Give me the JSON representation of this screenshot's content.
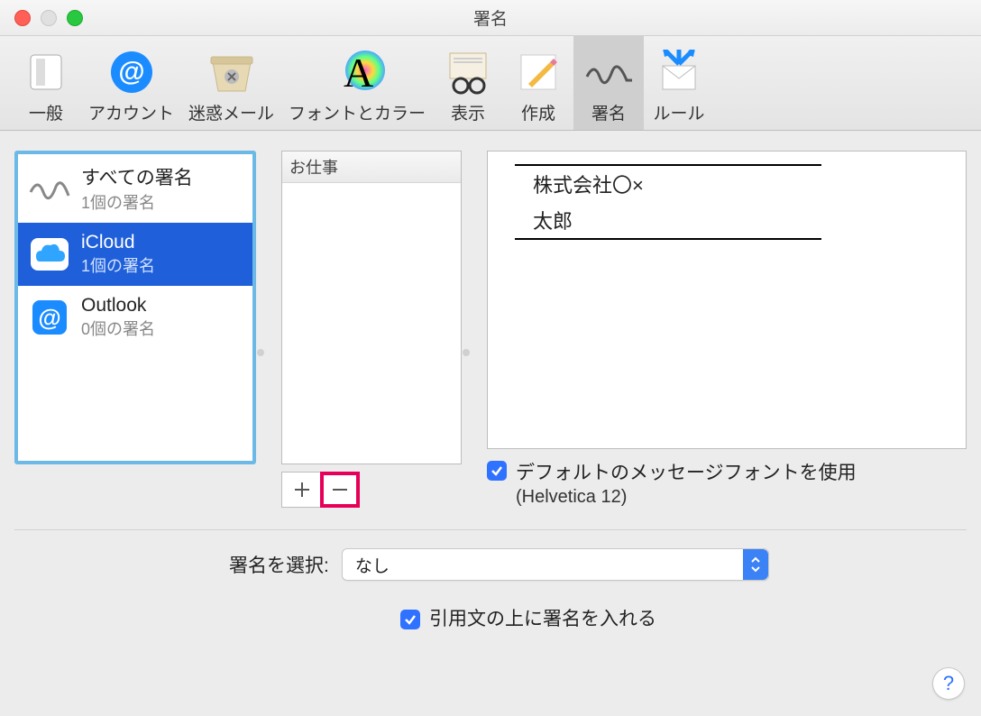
{
  "window": {
    "title": "署名"
  },
  "toolbar": {
    "items": [
      {
        "label": "一般"
      },
      {
        "label": "アカウント"
      },
      {
        "label": "迷惑メール"
      },
      {
        "label": "フォントとカラー"
      },
      {
        "label": "表示"
      },
      {
        "label": "作成"
      },
      {
        "label": "署名"
      },
      {
        "label": "ルール"
      }
    ]
  },
  "accounts": [
    {
      "title": "すべての署名",
      "subtitle": "1個の署名"
    },
    {
      "title": "iCloud",
      "subtitle": "1個の署名"
    },
    {
      "title": "Outlook",
      "subtitle": "0個の署名"
    }
  ],
  "signature_list": {
    "header": "お仕事"
  },
  "preview": {
    "line1": "株式会社〇×",
    "line2": "太郎"
  },
  "default_font": {
    "checked": true,
    "label": "デフォルトのメッセージフォントを使用",
    "detail": "(Helvetica 12)"
  },
  "choose": {
    "label": "署名を選択:",
    "value": "なし"
  },
  "place_above": {
    "checked": true,
    "label": "引用文の上に署名を入れる"
  },
  "help_tooltip": "?"
}
